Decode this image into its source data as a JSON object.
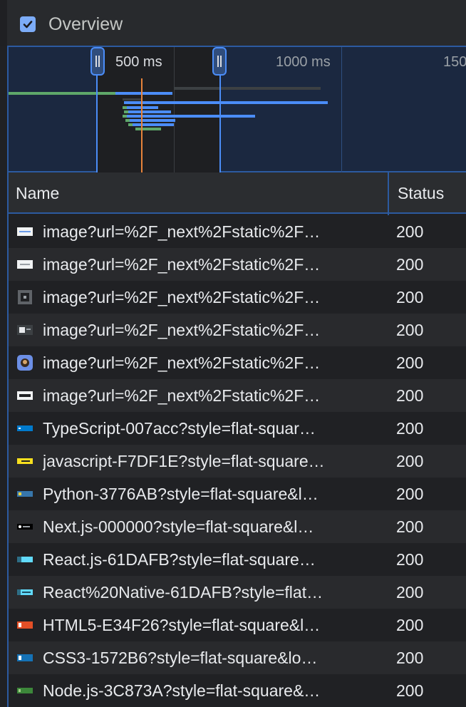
{
  "overview": {
    "checkbox_checked": true,
    "label": "Overview"
  },
  "timeline": {
    "ticks": [
      "500 ms",
      "1000 ms",
      "150"
    ],
    "selection_color": "#1e1f22",
    "accent": "#4b8df8"
  },
  "table": {
    "columns": [
      "Name",
      "Status"
    ],
    "rows": [
      {
        "name": "image?url=%2F_next%2Fstatic%2F…",
        "status": "200",
        "icon": "image-thumb-white-blue-icon"
      },
      {
        "name": "image?url=%2F_next%2Fstatic%2F…",
        "status": "200",
        "icon": "image-thumb-white-icon"
      },
      {
        "name": "image?url=%2F_next%2Fstatic%2F…",
        "status": "200",
        "icon": "image-thumb-dark-icon"
      },
      {
        "name": "image?url=%2F_next%2Fstatic%2F…",
        "status": "200",
        "icon": "image-thumb-gray-icon"
      },
      {
        "name": "image?url=%2F_next%2Fstatic%2F…",
        "status": "200",
        "icon": "image-thumb-avatar-icon"
      },
      {
        "name": "image?url=%2F_next%2Fstatic%2F…",
        "status": "200",
        "icon": "image-thumb-white-dark-icon"
      },
      {
        "name": "TypeScript-007acc?style=flat-squar…",
        "status": "200",
        "icon": "badge-typescript-icon"
      },
      {
        "name": "javascript-F7DF1E?style=flat-square…",
        "status": "200",
        "icon": "badge-javascript-icon"
      },
      {
        "name": "Python-3776AB?style=flat-square&l…",
        "status": "200",
        "icon": "badge-python-icon"
      },
      {
        "name": "Next.js-000000?style=flat-square&l…",
        "status": "200",
        "icon": "badge-nextjs-icon"
      },
      {
        "name": "React.js-61DAFB?style=flat-square…",
        "status": "200",
        "icon": "badge-react-icon"
      },
      {
        "name": "React%20Native-61DAFB?style=flat…",
        "status": "200",
        "icon": "badge-react-native-icon"
      },
      {
        "name": "HTML5-E34F26?style=flat-square&l…",
        "status": "200",
        "icon": "badge-html5-icon"
      },
      {
        "name": "CSS3-1572B6?style=flat-square&lo…",
        "status": "200",
        "icon": "badge-css3-icon"
      },
      {
        "name": "Node.js-3C873A?style=flat-square&…",
        "status": "200",
        "icon": "badge-nodejs-icon"
      }
    ]
  }
}
